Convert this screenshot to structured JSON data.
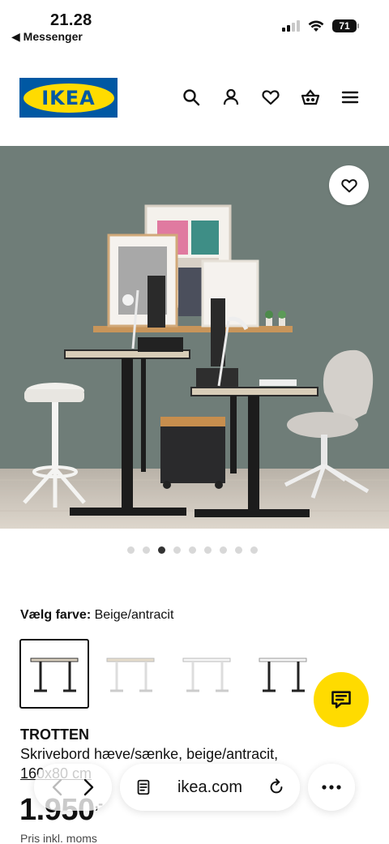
{
  "status_bar": {
    "time": "21.28",
    "back_app": "◀ Messenger",
    "battery": "71"
  },
  "header": {
    "logo_text": "IKEA",
    "icons": [
      "search-icon",
      "account-icon",
      "favorites-icon",
      "basket-icon",
      "menu-icon"
    ]
  },
  "gallery": {
    "image_count": 9,
    "active_index": 2
  },
  "color_selector": {
    "label": "Vælg farve:",
    "value": "Beige/antracit",
    "options": [
      "beige-anthracite",
      "white-white",
      "white",
      "white-anthracite"
    ],
    "selected_index": 0
  },
  "product": {
    "name": "TROTTEN",
    "description": "Skrivebord hæve/sænke, beige/antracit,",
    "dimensions": "160x80 cm",
    "price": "1.950",
    "price_suffix": ",-",
    "vat_note": "Pris inkl. moms"
  },
  "browser": {
    "url": "ikea.com"
  },
  "colors": {
    "ikea_blue": "#0058a3",
    "ikea_yellow": "#ffdb00",
    "wall": "#6f7d78"
  }
}
